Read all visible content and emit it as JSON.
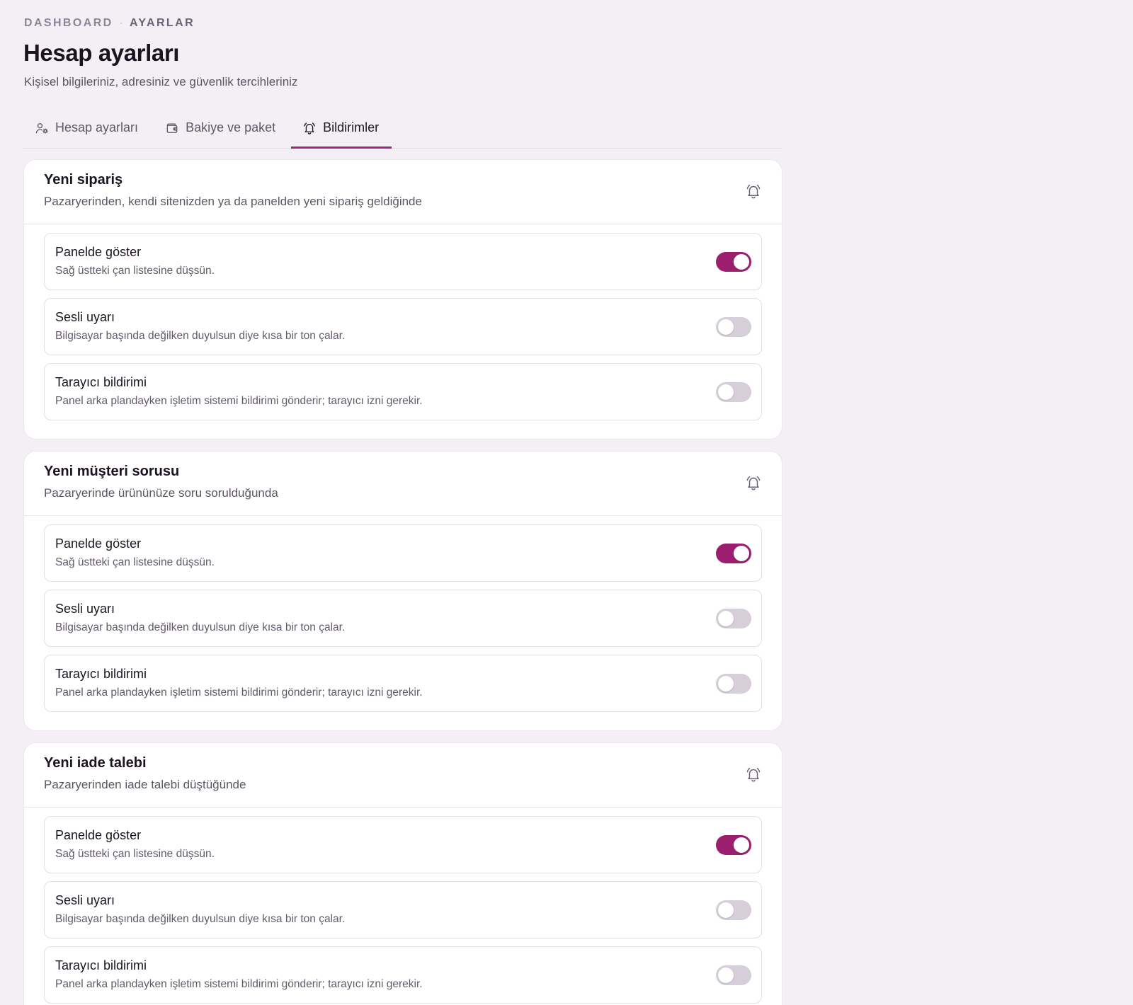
{
  "breadcrumb": {
    "root": "DASHBOARD",
    "separator": "·",
    "current": "AYARLAR"
  },
  "page": {
    "title": "Hesap ayarları",
    "subtitle": "Kişisel bilgileriniz, adresiniz ve güvenlik tercihleriniz"
  },
  "tabs": [
    {
      "label": "Hesap ayarları",
      "icon": "user-gear-icon",
      "active": false
    },
    {
      "label": "Bakiye ve paket",
      "icon": "wallet-icon",
      "active": false
    },
    {
      "label": "Bildirimler",
      "icon": "bell-icon",
      "active": true
    }
  ],
  "colors": {
    "accent": "#9c1f6f",
    "toggle_off": "#d6ced9",
    "background": "#f3eff5"
  },
  "cards": [
    {
      "title": "Yeni sipariş",
      "description": "Pazaryerinden, kendi sitenizden ya da panelden yeni sipariş geldiğinde",
      "icon": "bell-icon",
      "rows": [
        {
          "title": "Panelde göster",
          "description": "Sağ üstteki çan listesine düşsün.",
          "enabled": true
        },
        {
          "title": "Sesli uyarı",
          "description": "Bilgisayar başında değilken duyulsun diye kısa bir ton çalar.",
          "enabled": false
        },
        {
          "title": "Tarayıcı bildirimi",
          "description": "Panel arka plandayken işletim sistemi bildirimi gönderir; tarayıcı izni gerekir.",
          "enabled": false
        }
      ]
    },
    {
      "title": "Yeni müşteri sorusu",
      "description": "Pazaryerinde ürününüze soru sorulduğunda",
      "icon": "bell-icon",
      "rows": [
        {
          "title": "Panelde göster",
          "description": "Sağ üstteki çan listesine düşsün.",
          "enabled": true
        },
        {
          "title": "Sesli uyarı",
          "description": "Bilgisayar başında değilken duyulsun diye kısa bir ton çalar.",
          "enabled": false
        },
        {
          "title": "Tarayıcı bildirimi",
          "description": "Panel arka plandayken işletim sistemi bildirimi gönderir; tarayıcı izni gerekir.",
          "enabled": false
        }
      ]
    },
    {
      "title": "Yeni iade talebi",
      "description": "Pazaryerinden iade talebi düştüğünde",
      "icon": "bell-icon",
      "rows": [
        {
          "title": "Panelde göster",
          "description": "Sağ üstteki çan listesine düşsün.",
          "enabled": true
        },
        {
          "title": "Sesli uyarı",
          "description": "Bilgisayar başında değilken duyulsun diye kısa bir ton çalar.",
          "enabled": false
        },
        {
          "title": "Tarayıcı bildirimi",
          "description": "Panel arka plandayken işletim sistemi bildirimi gönderir; tarayıcı izni gerekir.",
          "enabled": false
        }
      ]
    }
  ]
}
